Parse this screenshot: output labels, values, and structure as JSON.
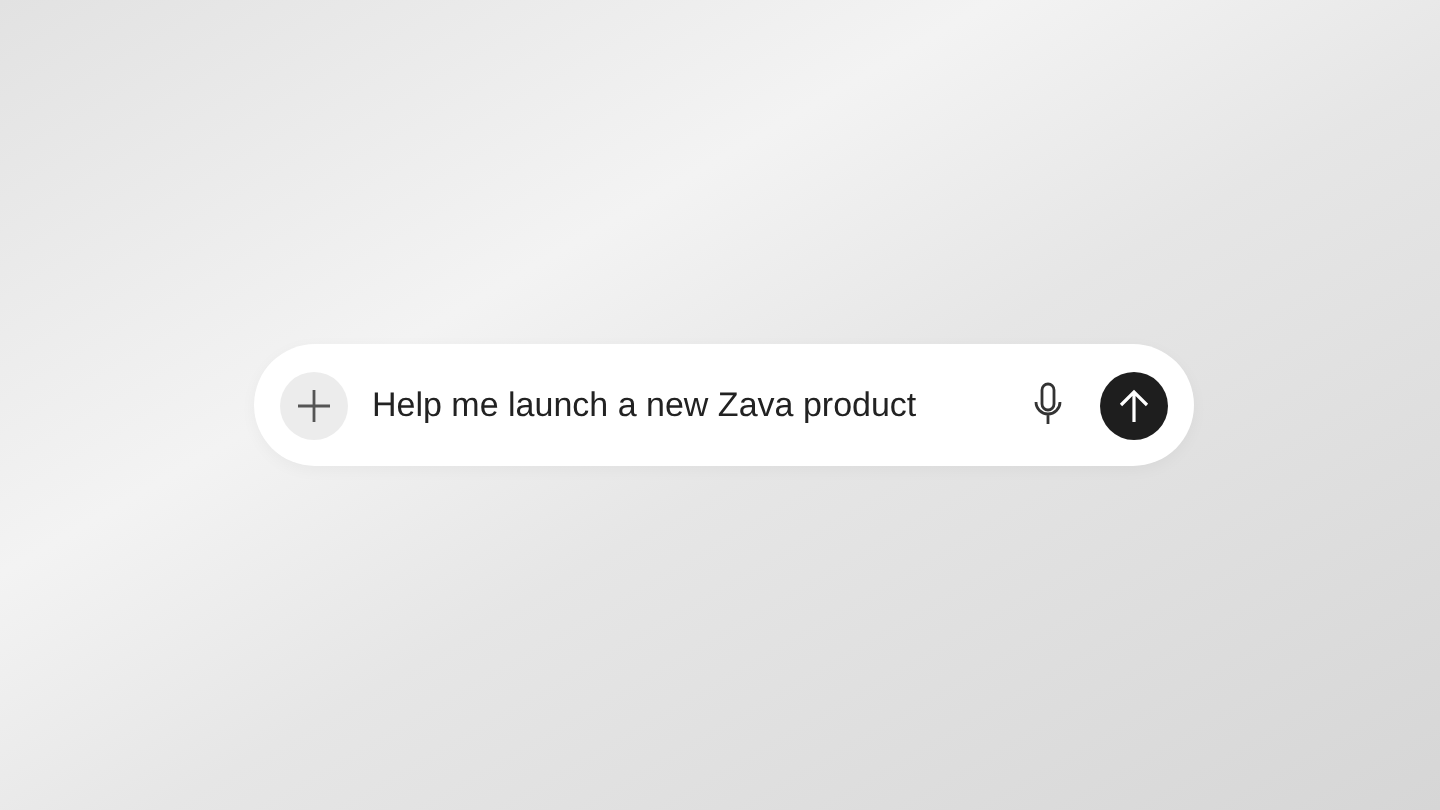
{
  "prompt": {
    "value": "Help me launch a new Zava product"
  }
}
